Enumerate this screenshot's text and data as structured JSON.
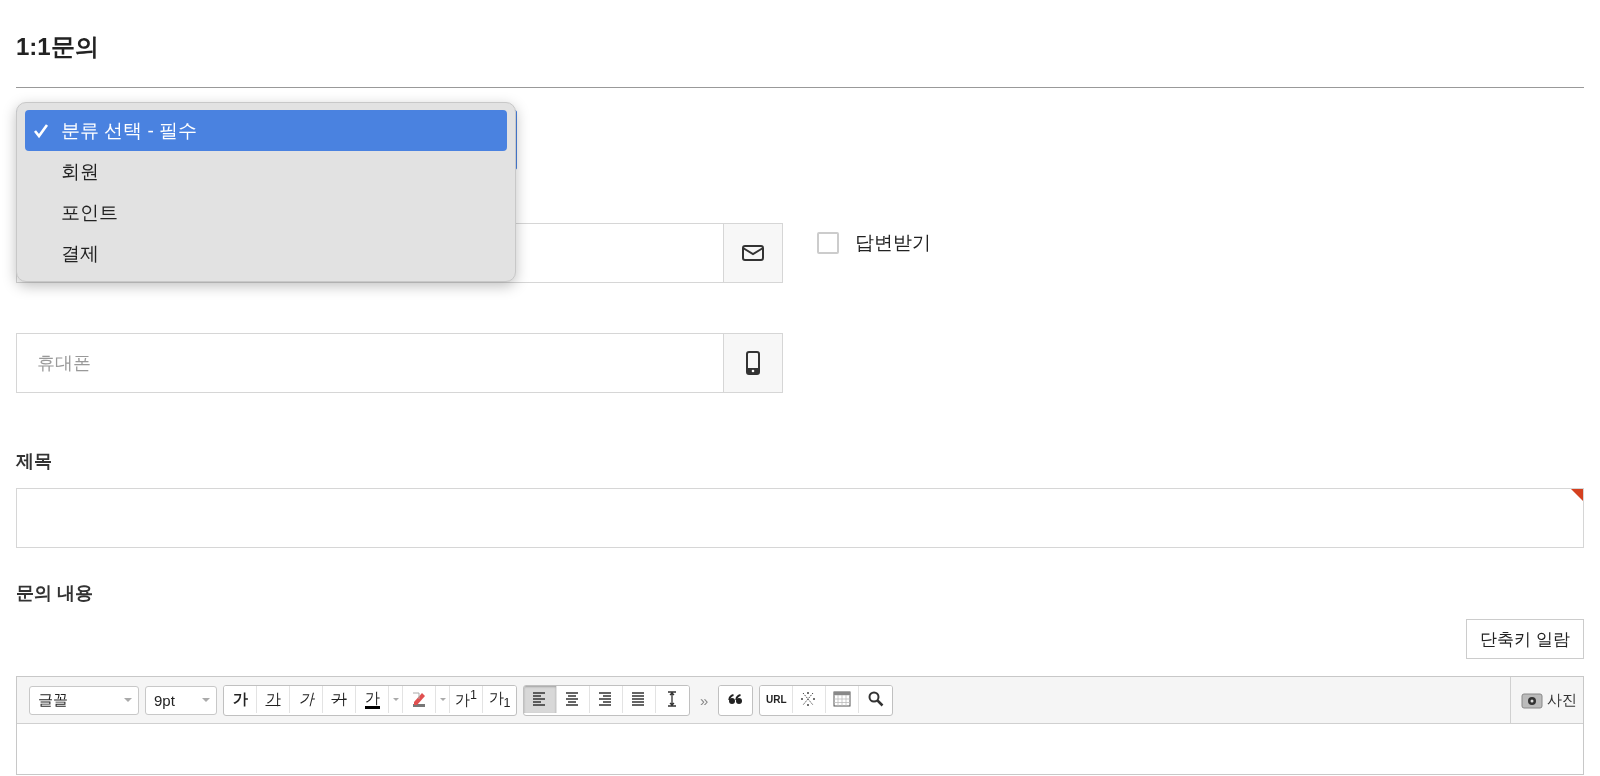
{
  "page": {
    "title": "1:1문의"
  },
  "category_select": {
    "expanded": true,
    "options": [
      {
        "label": "분류 선택 - 필수",
        "selected": true
      },
      {
        "label": "회원",
        "selected": false
      },
      {
        "label": "포인트",
        "selected": false
      },
      {
        "label": "결제",
        "selected": false
      }
    ]
  },
  "reply_checkbox": {
    "label": "답변받기",
    "checked": false
  },
  "phone_field": {
    "placeholder": "휴대폰"
  },
  "subject": {
    "label": "제목",
    "required": true
  },
  "content": {
    "label": "문의 내용",
    "shortcut_button": "단축키 일람"
  },
  "editor_toolbar": {
    "groups": [
      {
        "kind": "select",
        "items": [
          {
            "label": "글꼴"
          }
        ]
      },
      {
        "kind": "select",
        "items": [
          {
            "label": "9pt"
          }
        ]
      },
      {
        "kind": "buttons",
        "items": [
          {
            "kind": "bold",
            "label": "가"
          },
          {
            "kind": "underline",
            "label": "가"
          },
          {
            "kind": "italic",
            "label": "가"
          },
          {
            "kind": "strike",
            "label": "가"
          },
          {
            "kind": "color",
            "label": "가"
          },
          {
            "kind": "caret"
          },
          {
            "kind": "highlight"
          },
          {
            "kind": "caret"
          },
          {
            "kind": "plain",
            "label": "가$^{1}$"
          },
          {
            "kind": "plain",
            "label": "가$_{1}$"
          }
        ]
      },
      {
        "kind": "buttons",
        "items": [
          {
            "kind": "align-left",
            "selected": true
          },
          {
            "kind": "align-center",
            "selected": false
          },
          {
            "kind": "align-right",
            "selected": false
          },
          {
            "kind": "justify",
            "selected": false
          },
          {
            "kind": "line-height",
            "selected": false
          }
        ]
      },
      {
        "kind": "more",
        "items": [
          {
            "label": "»"
          }
        ]
      },
      {
        "kind": "buttons",
        "items": [
          {
            "kind": "quote"
          }
        ]
      },
      {
        "kind": "buttons",
        "items": [
          {
            "kind": "plain",
            "label": "URL"
          },
          {
            "kind": "special-char"
          },
          {
            "kind": "table"
          },
          {
            "kind": "search"
          }
        ]
      }
    ],
    "photo_button": "사진"
  }
}
